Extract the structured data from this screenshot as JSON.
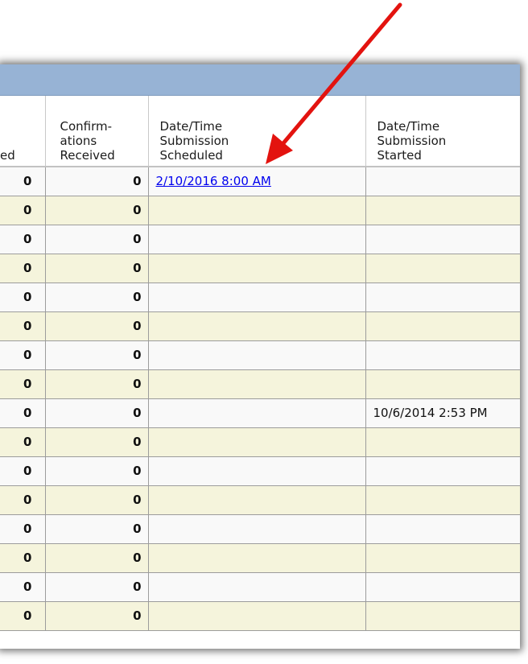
{
  "columns": [
    {
      "label": "ed"
    },
    {
      "label": "Confirm-\nations\nReceived"
    },
    {
      "label": "Date/Time\nSubmission\nScheduled"
    },
    {
      "label": "Date/Time\nSubmission\nStarted"
    }
  ],
  "rows": [
    {
      "left": "0",
      "confirmations": "0",
      "scheduled": "2/10/2016 8:00 AM",
      "started": ""
    },
    {
      "left": "0",
      "confirmations": "0",
      "scheduled": "",
      "started": ""
    },
    {
      "left": "0",
      "confirmations": "0",
      "scheduled": "",
      "started": ""
    },
    {
      "left": "0",
      "confirmations": "0",
      "scheduled": "",
      "started": ""
    },
    {
      "left": "0",
      "confirmations": "0",
      "scheduled": "",
      "started": ""
    },
    {
      "left": "0",
      "confirmations": "0",
      "scheduled": "",
      "started": ""
    },
    {
      "left": "0",
      "confirmations": "0",
      "scheduled": "",
      "started": ""
    },
    {
      "left": "0",
      "confirmations": "0",
      "scheduled": "",
      "started": ""
    },
    {
      "left": "0",
      "confirmations": "0",
      "scheduled": "",
      "started": "10/6/2014 2:53 PM"
    },
    {
      "left": "0",
      "confirmations": "0",
      "scheduled": "",
      "started": ""
    },
    {
      "left": "0",
      "confirmations": "0",
      "scheduled": "",
      "started": ""
    },
    {
      "left": "0",
      "confirmations": "0",
      "scheduled": "",
      "started": ""
    },
    {
      "left": "0",
      "confirmations": "0",
      "scheduled": "",
      "started": ""
    },
    {
      "left": "0",
      "confirmations": "0",
      "scheduled": "",
      "started": ""
    },
    {
      "left": "0",
      "confirmations": "0",
      "scheduled": "",
      "started": ""
    },
    {
      "left": "0",
      "confirmations": "0",
      "scheduled": "",
      "started": ""
    }
  ],
  "colors": {
    "title_bar": "#97b3d5",
    "row_even": "#f9f9f9",
    "row_odd": "#f5f4dc",
    "link": "#0000ee",
    "arrow": "#e3130f"
  }
}
